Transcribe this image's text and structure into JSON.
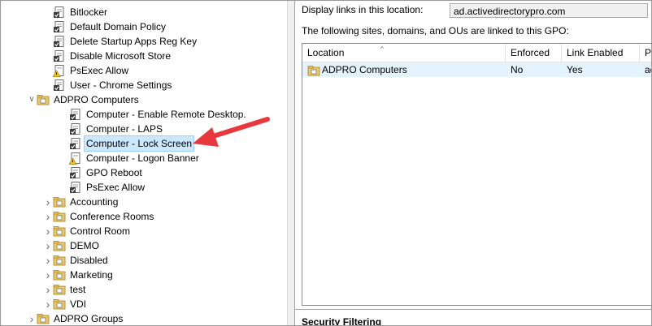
{
  "tree": {
    "items": [
      {
        "label": "Bitlocker",
        "icon": "gpo-icon",
        "indent": 68,
        "chevron": ""
      },
      {
        "label": "Default Domain Policy",
        "icon": "gpo-icon",
        "indent": 68,
        "chevron": ""
      },
      {
        "label": "Delete Startup Apps Reg Key",
        "icon": "gpo-icon",
        "indent": 68,
        "chevron": ""
      },
      {
        "label": "Disable Microsoft Store",
        "icon": "gpo-icon",
        "indent": 68,
        "chevron": ""
      },
      {
        "label": "PsExec Allow",
        "icon": "gpo-warning-icon",
        "indent": 68,
        "chevron": ""
      },
      {
        "label": "User - Chrome Settings",
        "icon": "gpo-icon",
        "indent": 68,
        "chevron": ""
      },
      {
        "label": "ADPRO Computers",
        "icon": "ou-folder-icon",
        "indent": 48,
        "chevron": "expanded"
      },
      {
        "label": "Computer - Enable Remote Desktop.",
        "icon": "gpo-icon",
        "indent": 88,
        "chevron": ""
      },
      {
        "label": "Computer - LAPS",
        "icon": "gpo-icon",
        "indent": 88,
        "chevron": ""
      },
      {
        "label": "Computer - Lock Screen",
        "icon": "gpo-icon",
        "indent": 88,
        "chevron": "",
        "selected": true
      },
      {
        "label": "Computer - Logon Banner",
        "icon": "gpo-warning-icon",
        "indent": 88,
        "chevron": ""
      },
      {
        "label": "GPO Reboot",
        "icon": "gpo-icon",
        "indent": 88,
        "chevron": ""
      },
      {
        "label": "PsExec Allow",
        "icon": "gpo-icon",
        "indent": 88,
        "chevron": ""
      },
      {
        "label": "Accounting",
        "icon": "ou-folder-icon",
        "indent": 68,
        "chevron": "collapsed"
      },
      {
        "label": "Conference Rooms",
        "icon": "ou-folder-icon",
        "indent": 68,
        "chevron": "collapsed"
      },
      {
        "label": "Control Room",
        "icon": "ou-folder-icon",
        "indent": 68,
        "chevron": "collapsed"
      },
      {
        "label": "DEMO",
        "icon": "ou-folder-icon",
        "indent": 68,
        "chevron": "collapsed"
      },
      {
        "label": "Disabled",
        "icon": "ou-folder-icon",
        "indent": 68,
        "chevron": "collapsed"
      },
      {
        "label": "Marketing",
        "icon": "ou-folder-icon",
        "indent": 68,
        "chevron": "collapsed"
      },
      {
        "label": "test",
        "icon": "ou-folder-icon",
        "indent": 68,
        "chevron": "collapsed"
      },
      {
        "label": "VDI",
        "icon": "ou-folder-icon",
        "indent": 68,
        "chevron": "collapsed"
      },
      {
        "label": "ADPRO Groups",
        "icon": "ou-folder-icon",
        "indent": 48,
        "chevron": "collapsed"
      }
    ]
  },
  "scope": {
    "display_label": "Display links in this location:",
    "display_value": "ad.activedirectorypro.com",
    "linked_label": "The following sites, domains, and OUs are linked to this GPO:",
    "columns": [
      "Location",
      "Enforced",
      "Link Enabled",
      "P"
    ],
    "rows": [
      {
        "location": "ADPRO Computers",
        "enforced": "No",
        "link_enabled": "Yes",
        "path": "ac"
      }
    ],
    "security_filtering": "Security Filtering"
  },
  "colors": {
    "selection": "#cce8ff",
    "arrow": "#e8383d",
    "row_highlight": "#e5f3ff"
  }
}
